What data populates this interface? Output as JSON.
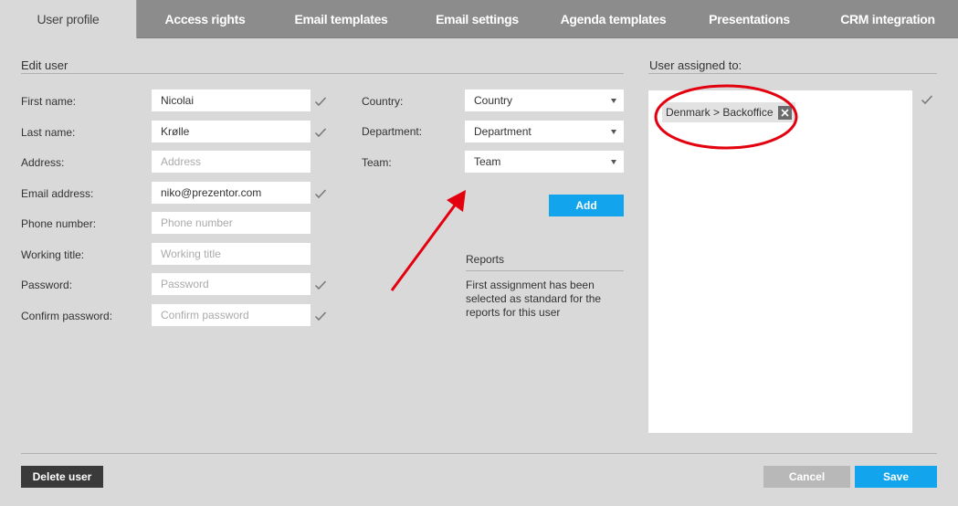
{
  "tabs": [
    {
      "label": "User profile"
    },
    {
      "label": "Access rights"
    },
    {
      "label": "Email templates"
    },
    {
      "label": "Email settings"
    },
    {
      "label": "Agenda templates"
    },
    {
      "label": "Presentations"
    },
    {
      "label": "CRM integration"
    }
  ],
  "edit_user": {
    "title": "Edit user",
    "fields": [
      {
        "label": "First name:",
        "value": "Nicolai",
        "placeholder": "",
        "checked": true
      },
      {
        "label": "Last name:",
        "value": "Krølle",
        "placeholder": "",
        "checked": true
      },
      {
        "label": "Address:",
        "value": "",
        "placeholder": "Address",
        "checked": false
      },
      {
        "label": "Email address:",
        "value": "niko@prezentor.com",
        "placeholder": "",
        "checked": true
      },
      {
        "label": "Phone number:",
        "value": "",
        "placeholder": "Phone number",
        "checked": false
      },
      {
        "label": "Working title:",
        "value": "",
        "placeholder": "Working title",
        "checked": false
      },
      {
        "label": "Password:",
        "value": "",
        "placeholder": "Password",
        "checked": true
      },
      {
        "label": "Confirm password:",
        "value": "",
        "placeholder": "Confirm password",
        "checked": true
      }
    ]
  },
  "assignment": {
    "country": {
      "label": "Country:",
      "selected": "Country"
    },
    "department": {
      "label": "Department:",
      "selected": "Department"
    },
    "team": {
      "label": "Team:",
      "selected": "Team"
    },
    "add_label": "Add"
  },
  "reports": {
    "title": "Reports",
    "text": "First assignment has been selected as standard for the reports for this user"
  },
  "user_assigned": {
    "title": "User assigned to:",
    "tags": [
      "Denmark > Backoffice"
    ]
  },
  "footer": {
    "delete_label": "Delete user",
    "cancel_label": "Cancel",
    "save_label": "Save"
  },
  "colors": {
    "accent": "#12a4ec",
    "annotation": "#e3000f",
    "tab_bar": "#8c8c8c"
  }
}
